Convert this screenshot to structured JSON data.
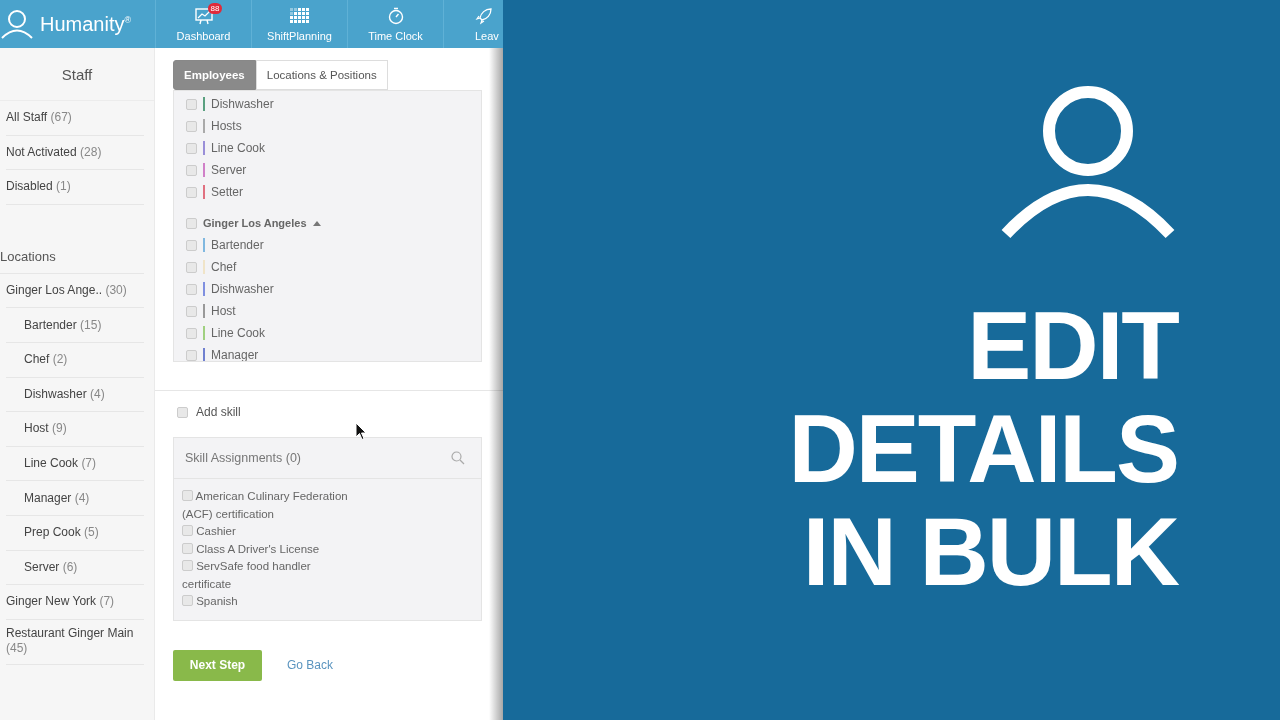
{
  "header": {
    "brand": "Humanity",
    "brand_mark": "®",
    "nav": [
      {
        "label": "Dashboard",
        "badge": "88"
      },
      {
        "label": "ShiftPlanning"
      },
      {
        "label": "Time Clock"
      },
      {
        "label": "Leav"
      }
    ]
  },
  "sidebar": {
    "title": "Staff",
    "filters": [
      {
        "label": "All Staff",
        "count": "(67)"
      },
      {
        "label": "Not Activated",
        "count": "(28)"
      },
      {
        "label": "Disabled",
        "count": "(1)"
      }
    ],
    "locations_heading": "Locations",
    "locations": [
      {
        "label": "Ginger Los Ange..",
        "count": "(30)",
        "children": [
          {
            "label": "Bartender",
            "count": "(15)"
          },
          {
            "label": "Chef",
            "count": "(2)"
          },
          {
            "label": "Dishwasher",
            "count": "(4)"
          },
          {
            "label": "Host",
            "count": "(9)"
          },
          {
            "label": "Line Cook",
            "count": "(7)"
          },
          {
            "label": "Manager",
            "count": "(4)"
          },
          {
            "label": "Prep Cook",
            "count": "(5)"
          },
          {
            "label": "Server",
            "count": "(6)"
          }
        ]
      },
      {
        "label": "Ginger New York",
        "count": "(7)"
      },
      {
        "label": "Restaurant Ginger Main",
        "count": "(45)"
      }
    ]
  },
  "tabs": [
    {
      "label": "Employees",
      "selected": true
    },
    {
      "label": "Locations & Positions",
      "selected": false
    }
  ],
  "position_rows": [
    {
      "kind": "position",
      "label": "Dishwasher",
      "color": "#5aa080",
      "checked": false
    },
    {
      "kind": "position",
      "label": "Hosts",
      "color": "#aaaaaa",
      "checked": false
    },
    {
      "kind": "position",
      "label": "Line Cook",
      "color": "#9a8fd8",
      "checked": false
    },
    {
      "kind": "position",
      "label": "Server",
      "color": "#d080c8",
      "checked": false
    },
    {
      "kind": "position",
      "label": "Setter",
      "color": "#e07080",
      "checked": false
    },
    {
      "kind": "location",
      "label": "Ginger Los Angeles",
      "checked": false,
      "expanded": true
    },
    {
      "kind": "position",
      "label": "Bartender",
      "color": "#80b8e0",
      "checked": false
    },
    {
      "kind": "position",
      "label": "Chef",
      "color": "#f0e4c8",
      "checked": false
    },
    {
      "kind": "position",
      "label": "Dishwasher",
      "color": "#8090e0",
      "checked": false
    },
    {
      "kind": "position",
      "label": "Host",
      "color": "#999999",
      "checked": false
    },
    {
      "kind": "position",
      "label": "Line Cook",
      "color": "#a0d080",
      "checked": false
    },
    {
      "kind": "position",
      "label": "Manager",
      "color": "#7080d0",
      "checked": false
    }
  ],
  "add_skill": {
    "label": "Add skill",
    "checked": false
  },
  "skills": {
    "title": "Skill Assignments (0)",
    "items": [
      {
        "label": "American Culinary Federation (ACF) certification",
        "checked": false
      },
      {
        "label": "Cashier",
        "checked": false
      },
      {
        "label": "Class A Driver's License",
        "checked": false
      },
      {
        "label": "ServSafe food handler certificate",
        "checked": false
      },
      {
        "label": "Spanish",
        "checked": false
      }
    ]
  },
  "actions": {
    "primary": "Next Step",
    "secondary": "Go Back"
  },
  "title_card": {
    "lines": [
      "EDIT",
      "DETAILS",
      "IN BULK"
    ]
  }
}
